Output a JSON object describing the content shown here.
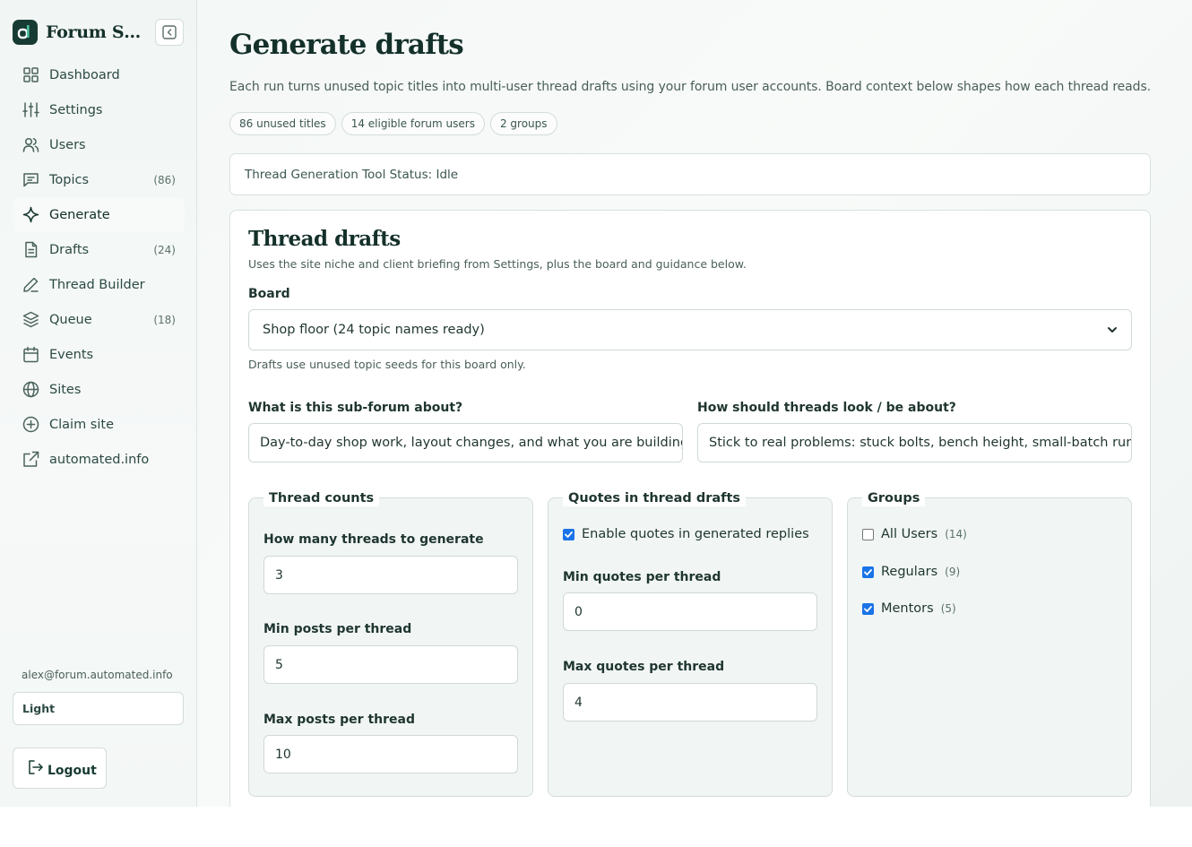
{
  "app": {
    "brand_name": "Forum Seeder",
    "brand_letter": "a"
  },
  "sidebar": {
    "items": [
      {
        "label": "Dashboard",
        "count": ""
      },
      {
        "label": "Settings",
        "count": ""
      },
      {
        "label": "Users",
        "count": ""
      },
      {
        "label": "Topics",
        "count": "(86)"
      },
      {
        "label": "Generate",
        "count": ""
      },
      {
        "label": "Drafts",
        "count": "(24)"
      },
      {
        "label": "Thread Builder",
        "count": ""
      },
      {
        "label": "Queue",
        "count": "(18)"
      },
      {
        "label": "Events",
        "count": ""
      },
      {
        "label": "Sites",
        "count": ""
      },
      {
        "label": "Claim site",
        "count": ""
      },
      {
        "label": "automated.info",
        "count": ""
      }
    ],
    "active_item": "Generate",
    "user_email": "alex@forum.automated.info",
    "theme_value": "Light",
    "logout_label": "Logout"
  },
  "page": {
    "title": "Generate drafts",
    "description": "Each run turns unused topic titles into multi-user thread drafts using your forum user accounts. Board context below shapes how each thread reads.",
    "chips": [
      "86 unused titles",
      "14 eligible forum users",
      "2 groups"
    ],
    "status": "Thread Generation Tool Status: Idle"
  },
  "card": {
    "title": "Thread drafts",
    "subtitle": "Uses the site niche and client briefing from Settings, plus the board and guidance below.",
    "board_label": "Board",
    "board_value": "Shop floor (24 topic names ready)",
    "board_hint": "Drafts use unused topic seeds for this board only.",
    "subforum_label": "What is this sub-forum about?",
    "subforum_value": "Day-to-day shop work, layout changes, and what you are building this week.",
    "threads_label": "How should threads look / be about?",
    "threads_value": "Stick to real problems: stuck bolts, bench height, small-batch runs."
  },
  "thread_counts": {
    "legend": "Thread counts",
    "how_many_label": "How many threads to generate",
    "how_many_value": "3",
    "min_posts_label": "Min posts per thread",
    "min_posts_value": "5",
    "max_posts_label": "Max posts per thread",
    "max_posts_value": "10"
  },
  "quotes": {
    "legend": "Quotes in thread drafts",
    "enable_label": "Enable quotes in generated replies",
    "enable_checked": true,
    "min_label": "Min quotes per thread",
    "min_value": "0",
    "max_label": "Max quotes per thread",
    "max_value": "4"
  },
  "groups": {
    "legend": "Groups",
    "items": [
      {
        "label": "All Users",
        "count": "(14)",
        "checked": false
      },
      {
        "label": "Regulars",
        "count": "(9)",
        "checked": true
      },
      {
        "label": "Mentors",
        "count": "(5)",
        "checked": true
      }
    ]
  },
  "colors": {
    "brand": "#173b33",
    "accent_check": "#1a73e8",
    "panel": "#f1f6f4"
  }
}
